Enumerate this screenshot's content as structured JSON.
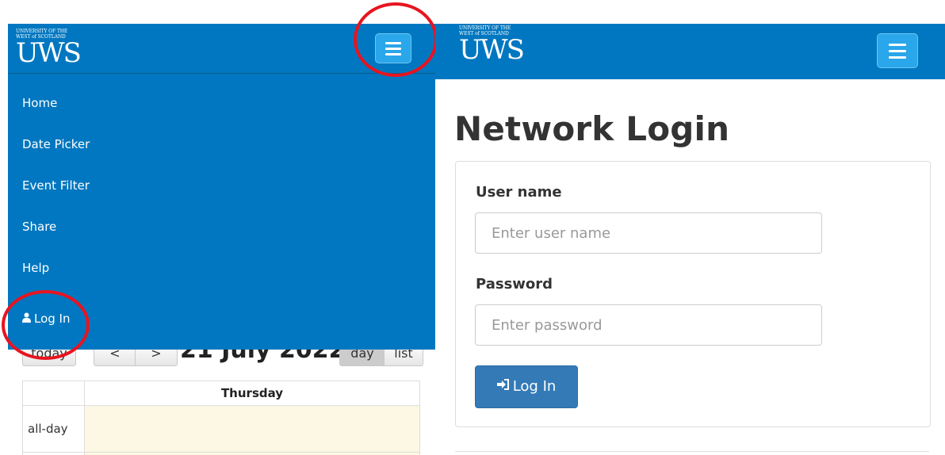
{
  "left_panel": {
    "logo": {
      "line1": "UNIVERSITY OF THE",
      "line2": "WEST of SCOTLAND",
      "mark": "UWS"
    },
    "menu_button_icon": "hamburger-menu-icon",
    "menu": {
      "items": [
        {
          "label": "Home"
        },
        {
          "label": "Date Picker"
        },
        {
          "label": "Event Filter"
        },
        {
          "label": "Share"
        },
        {
          "label": "Help"
        }
      ],
      "login": {
        "icon": "user-icon",
        "label": "Log In"
      }
    },
    "calendar": {
      "today_label": "today",
      "prev_label": "<",
      "next_label": ">",
      "title": "21 July 2022",
      "view_buttons": [
        {
          "label": "day",
          "active": true
        },
        {
          "label": "list",
          "active": false
        }
      ],
      "day_header": "Thursday",
      "allday_label": "all-day"
    },
    "annotation_color": "#e8141f"
  },
  "right_panel": {
    "logo": {
      "line1": "UNIVERSITY OF THE",
      "line2": "WEST of SCOTLAND",
      "mark": "UWS"
    },
    "menu_button_icon": "hamburger-menu-icon",
    "page_title": "Network Login",
    "form": {
      "username_label": "User name",
      "username_placeholder": "Enter user name",
      "password_label": "Password",
      "password_placeholder": "Enter password",
      "submit_icon": "sign-in-icon",
      "submit_label": "Log In"
    }
  },
  "colors": {
    "brand_blue": "#0077c0",
    "menu_button": "#2aa6ea",
    "primary_button": "#337ab7",
    "allday_bg": "#fcf8e3"
  }
}
